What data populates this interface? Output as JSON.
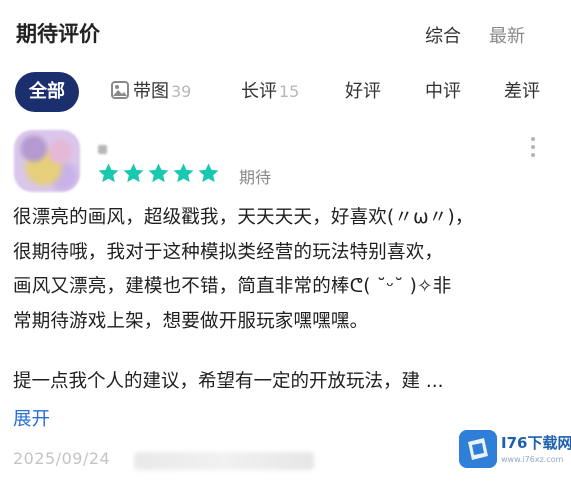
{
  "header": {
    "title": "期待评价",
    "sort_options": [
      "综合",
      "最新"
    ]
  },
  "filters": [
    {
      "label": "全部",
      "count": "",
      "active": true
    },
    {
      "label": "带图",
      "count": "39",
      "icon": "image-icon"
    },
    {
      "label": "长评",
      "count": "15"
    },
    {
      "label": "好评",
      "count": ""
    },
    {
      "label": "中评",
      "count": ""
    },
    {
      "label": "差评",
      "count": ""
    }
  ],
  "review": {
    "rating": 5,
    "rating_max": 5,
    "tag": "期待",
    "content": "很漂亮的画风，超级戳我，天天天天，好喜欢(〃ω〃)，\n很期待哦，我对于这种模拟类经营的玩法特别喜欢，\n画风又漂亮，建模也不错，简直非常的棒ᕦ( ˘ᵕ˘ )✧非\n常期待游戏上架，想要做开服玩家嘿嘿嘿。",
    "excerpt": "提一点我个人的建议，希望有一定的开放玩法，建 ...",
    "expand_label": "展开",
    "date": "2025/09/24"
  },
  "watermark": {
    "name": "I76下载网",
    "url": "www.i76xz.com"
  },
  "colors": {
    "active_chip": "#1b2f6e",
    "star": "#18c9b0",
    "link": "#2a6fd6"
  }
}
